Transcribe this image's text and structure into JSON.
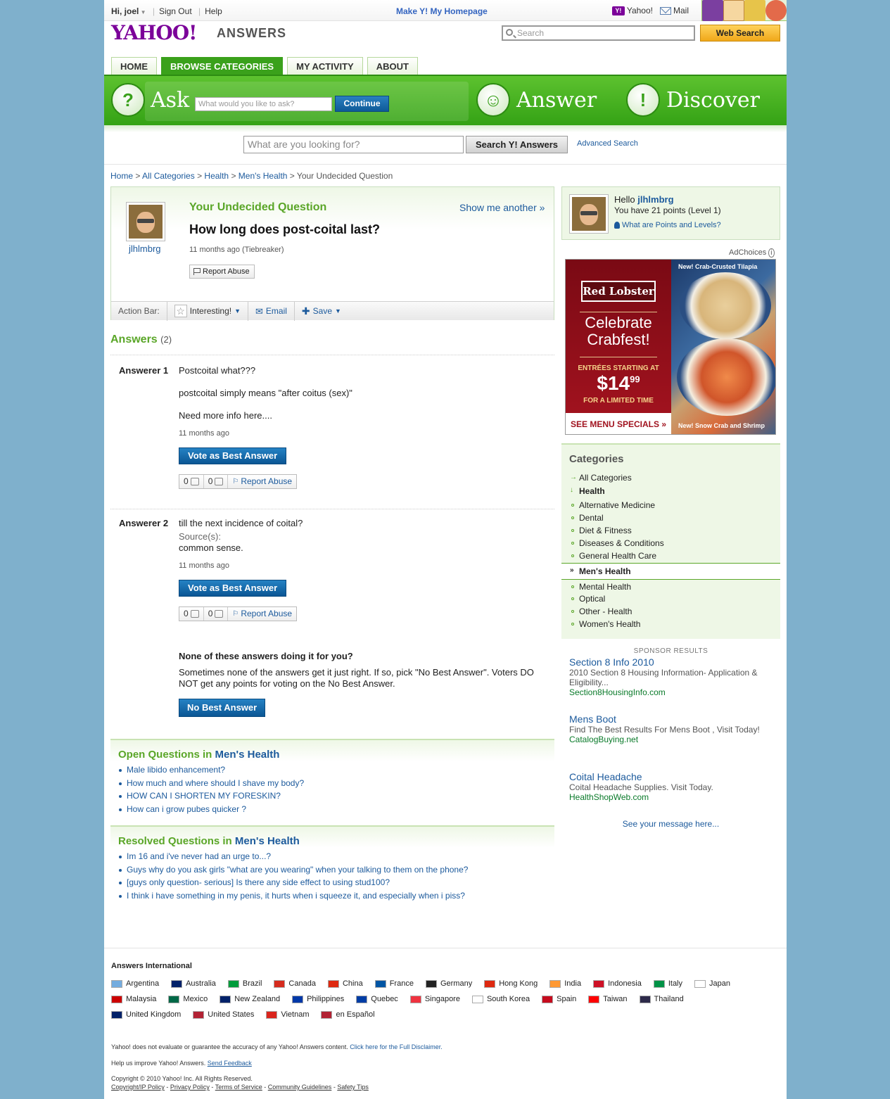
{
  "header": {
    "greeting": "Hi, joel",
    "sign_out": "Sign Out",
    "help": "Help",
    "make_homepage": "Make Y! My Homepage",
    "yahoo": "Yahoo!",
    "mail": "Mail"
  },
  "brand": {
    "logo": "YAHOO!",
    "product": "ANSWERS"
  },
  "top_search": {
    "placeholder": "Search",
    "button": "Web Search"
  },
  "tabs": [
    {
      "label": "HOME"
    },
    {
      "label": "BROWSE CATEGORIES"
    },
    {
      "label": "MY ACTIVITY"
    },
    {
      "label": "ABOUT"
    }
  ],
  "band": {
    "ask": "Ask",
    "ask_placeholder": "What would you like to ask?",
    "continue": "Continue",
    "answer": "Answer",
    "discover": "Discover"
  },
  "answers_search": {
    "placeholder": "What are you looking for?",
    "button": "Search Y! Answers",
    "advanced": "Advanced Search"
  },
  "breadcrumb": [
    "Home",
    "All Categories",
    "Health",
    "Men's Health",
    "Your Undecided Question"
  ],
  "question": {
    "kicker": "Your Undecided Question",
    "show_another": "Show me another »",
    "title": "How long does post-coital last?",
    "meta": "11 months ago (Tiebreaker)",
    "report": "Report Abuse",
    "user": "jlhlmbrg",
    "action_bar_label": "Action Bar:",
    "interesting": "Interesting!",
    "email": "Email",
    "save": "Save"
  },
  "answers": {
    "heading": "Answers",
    "count": "(2)",
    "items": [
      {
        "who": "Answerer 1",
        "lines": [
          "Postcoital what???",
          "postcoital simply means \"after coitus (sex)\"",
          "Need more info here...."
        ],
        "time": "11 months ago",
        "vote": "Vote as Best Answer",
        "up": "0",
        "down": "0",
        "report": "Report Abuse"
      },
      {
        "who": "Answerer 2",
        "lines": [
          "till the next incidence of coital?"
        ],
        "source_label": "Source(s):",
        "source": "common sense.",
        "time": "11 months ago",
        "vote": "Vote as Best Answer",
        "up": "0",
        "down": "0",
        "report": "Report Abuse"
      }
    ],
    "none_heading": "None of these answers doing it for you?",
    "none_text": "Sometimes none of the answers get it just right. If so, pick \"No Best Answer\". Voters DO NOT get any points for voting on the No Best Answer.",
    "none_button": "No Best Answer"
  },
  "open_questions": {
    "prefix": "Open Questions in",
    "category": "Men's Health",
    "items": [
      "Male libido enhancement?",
      "How much and where should I shave my body?",
      "HOW CAN I SHORTEN MY FORESKIN?",
      "How can i grow pubes quicker ?"
    ]
  },
  "resolved_questions": {
    "prefix": "Resolved Questions in",
    "category": "Men's Health",
    "items": [
      "Im 16 and i've never had an urge to...?",
      "Guys why do you ask girls \"what are you wearing\" when your talking to them on the phone?",
      "[guys only question- serious] Is there any side effect to using stud100?",
      "I think i have something in my penis, it hurts when i squeeze it, and especially when i piss?"
    ]
  },
  "profile": {
    "hello": "Hello",
    "name": "jlhlmbrg",
    "points": "You have 21 points (Level 1)",
    "points_link": "What are Points and Levels?"
  },
  "ad": {
    "adchoices": "AdChoices",
    "brand": "Red Lobster",
    "headline": "Celebrate Crabfest!",
    "entrees": "ENTRÉES STARTING AT",
    "price": "$14",
    "cents": "99",
    "limited": "FOR A LIMITED TIME",
    "cta": "SEE MENU SPECIALS »",
    "dish1": "New! Crab-Crusted Tilapia",
    "dish2": "New! Snow Crab and Shrimp"
  },
  "categories": {
    "heading": "Categories",
    "all": "All Categories",
    "health": "Health",
    "items_before": [
      "Alternative Medicine",
      "Dental",
      "Diet & Fitness",
      "Diseases & Conditions",
      "General Health Care"
    ],
    "selected": "Men's Health",
    "items_after": [
      "Mental Health",
      "Optical",
      "Other - Health",
      "Women's Health"
    ]
  },
  "sponsor": {
    "heading": "SPONSOR RESULTS",
    "items": [
      {
        "title": "Section 8 Info 2010",
        "desc": "2010 Section 8 Housing Information- Application & Eligibility...",
        "url": "Section8HousingInfo.com"
      },
      {
        "title": "Mens Boot",
        "desc": "Find The Best Results For Mens Boot , Visit Today!",
        "url": "CatalogBuying.net"
      },
      {
        "title": "Coital Headache",
        "desc": "Coital Headache Supplies. Visit Today.",
        "url": "HealthShopWeb.com"
      }
    ],
    "see_message": "See your message here..."
  },
  "footer": {
    "intl_heading": "Answers International",
    "countries": [
      {
        "name": "Argentina",
        "color": "#74acdf"
      },
      {
        "name": "Australia",
        "color": "#012169"
      },
      {
        "name": "Brazil",
        "color": "#009c3b"
      },
      {
        "name": "Canada",
        "color": "#d52b1e"
      },
      {
        "name": "China",
        "color": "#de2910"
      },
      {
        "name": "France",
        "color": "#0055a4"
      },
      {
        "name": "Germany",
        "color": "#222222"
      },
      {
        "name": "Hong Kong",
        "color": "#de2910"
      },
      {
        "name": "India",
        "color": "#ff9933"
      },
      {
        "name": "Indonesia",
        "color": "#ce1126"
      },
      {
        "name": "Italy",
        "color": "#009246"
      },
      {
        "name": "Japan",
        "color": "#ffffff"
      },
      {
        "name": "Malaysia",
        "color": "#cc0001"
      },
      {
        "name": "Mexico",
        "color": "#006847"
      },
      {
        "name": "New Zealand",
        "color": "#012169"
      },
      {
        "name": "Philippines",
        "color": "#0038a8"
      },
      {
        "name": "Quebec",
        "color": "#003da5"
      },
      {
        "name": "Singapore",
        "color": "#ef3340"
      },
      {
        "name": "South Korea",
        "color": "#ffffff"
      },
      {
        "name": "Spain",
        "color": "#c60b1e"
      },
      {
        "name": "Taiwan",
        "color": "#fe0000"
      },
      {
        "name": "Thailand",
        "color": "#2d2a4a"
      },
      {
        "name": "United Kingdom",
        "color": "#012169"
      },
      {
        "name": "United States",
        "color": "#b22234"
      },
      {
        "name": "Vietnam",
        "color": "#da251d"
      },
      {
        "name": "en Español",
        "color": "#b22234"
      }
    ],
    "disclaimer": "Yahoo! does not evaluate or guarantee the accuracy of any Yahoo! Answers content.",
    "disclaimer_link": "Click here for the Full Disclaimer.",
    "help_text": "Help us improve Yahoo! Answers.",
    "feedback": "Send Feedback",
    "copyright": "Copyright © 2010 Yahoo! Inc. All Rights Reserved.",
    "links": [
      "Copyright/IP Policy",
      "Privacy Policy",
      "Terms of Service",
      "Community Guidelines",
      "Safety Tips"
    ]
  }
}
